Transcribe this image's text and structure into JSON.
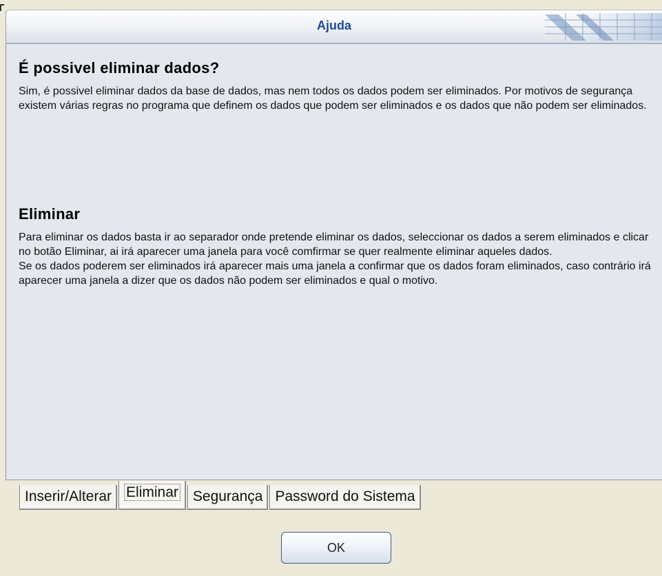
{
  "window": {
    "title": "Ajuda"
  },
  "sections": [
    {
      "heading": "É possivel eliminar dados?",
      "text": "  Sim, é possivel eliminar dados da base de dados, mas nem todos os dados podem ser eliminados. Por motivos de segurança existem várias regras no programa que definem os dados que podem ser eliminados e os dados que não podem ser eliminados."
    },
    {
      "heading": "Eliminar",
      "text": "  Para eliminar os dados basta ir ao separador onde pretende eliminar os dados, seleccionar os dados a serem eliminados e clicar no botão Eliminar, ai irá aparecer uma janela para você comfirmar se quer realmente eliminar aqueles dados.\n  Se os dados poderem ser eliminados irá aparecer mais uma janela a confirmar que os dados foram eliminados, caso contrário irá aparecer uma janela a dizer que os dados não podem ser eliminados e qual o motivo."
    }
  ],
  "tabs": [
    {
      "label": "Inserir/Alterar",
      "active": false
    },
    {
      "label": "Eliminar",
      "active": true
    },
    {
      "label": "Segurança",
      "active": false
    },
    {
      "label": "Password do Sistema",
      "active": false
    }
  ],
  "ok_button": {
    "label": "OK"
  },
  "colors": {
    "title": "#1b4c9b",
    "content_bg": "#e4e7ee",
    "window_bg": "#ece9d8"
  }
}
